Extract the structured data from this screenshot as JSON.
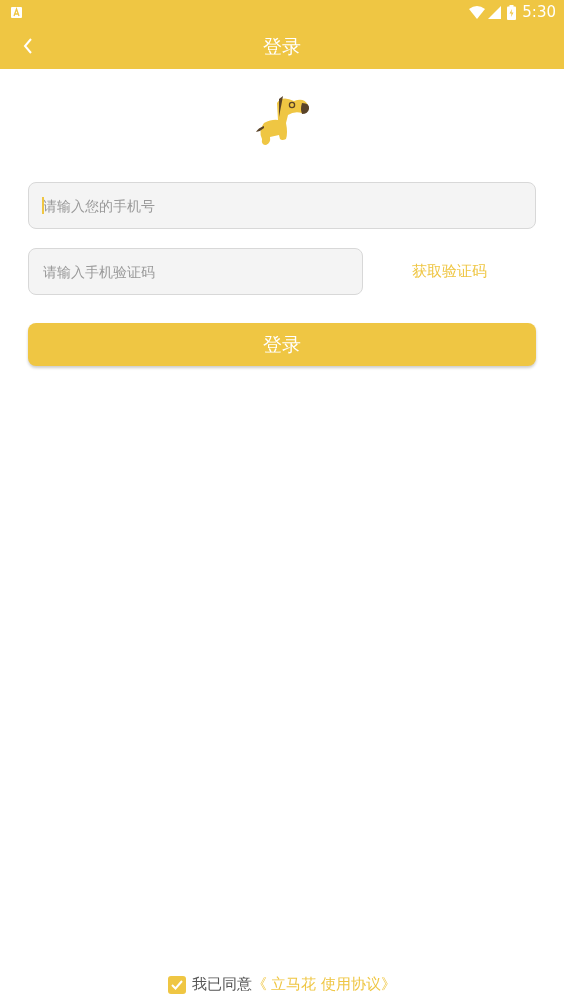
{
  "status_bar": {
    "time": "5:30"
  },
  "toolbar": {
    "title": "登录"
  },
  "phone_field": {
    "placeholder": "请输入您的手机号",
    "focused": true
  },
  "code_field": {
    "placeholder": "请输入手机验证码"
  },
  "get_code_link": "获取验证码",
  "login_button": "登录",
  "agreement": {
    "checked": true,
    "text": "我已同意",
    "link": "《 立马花 使用协议》"
  }
}
